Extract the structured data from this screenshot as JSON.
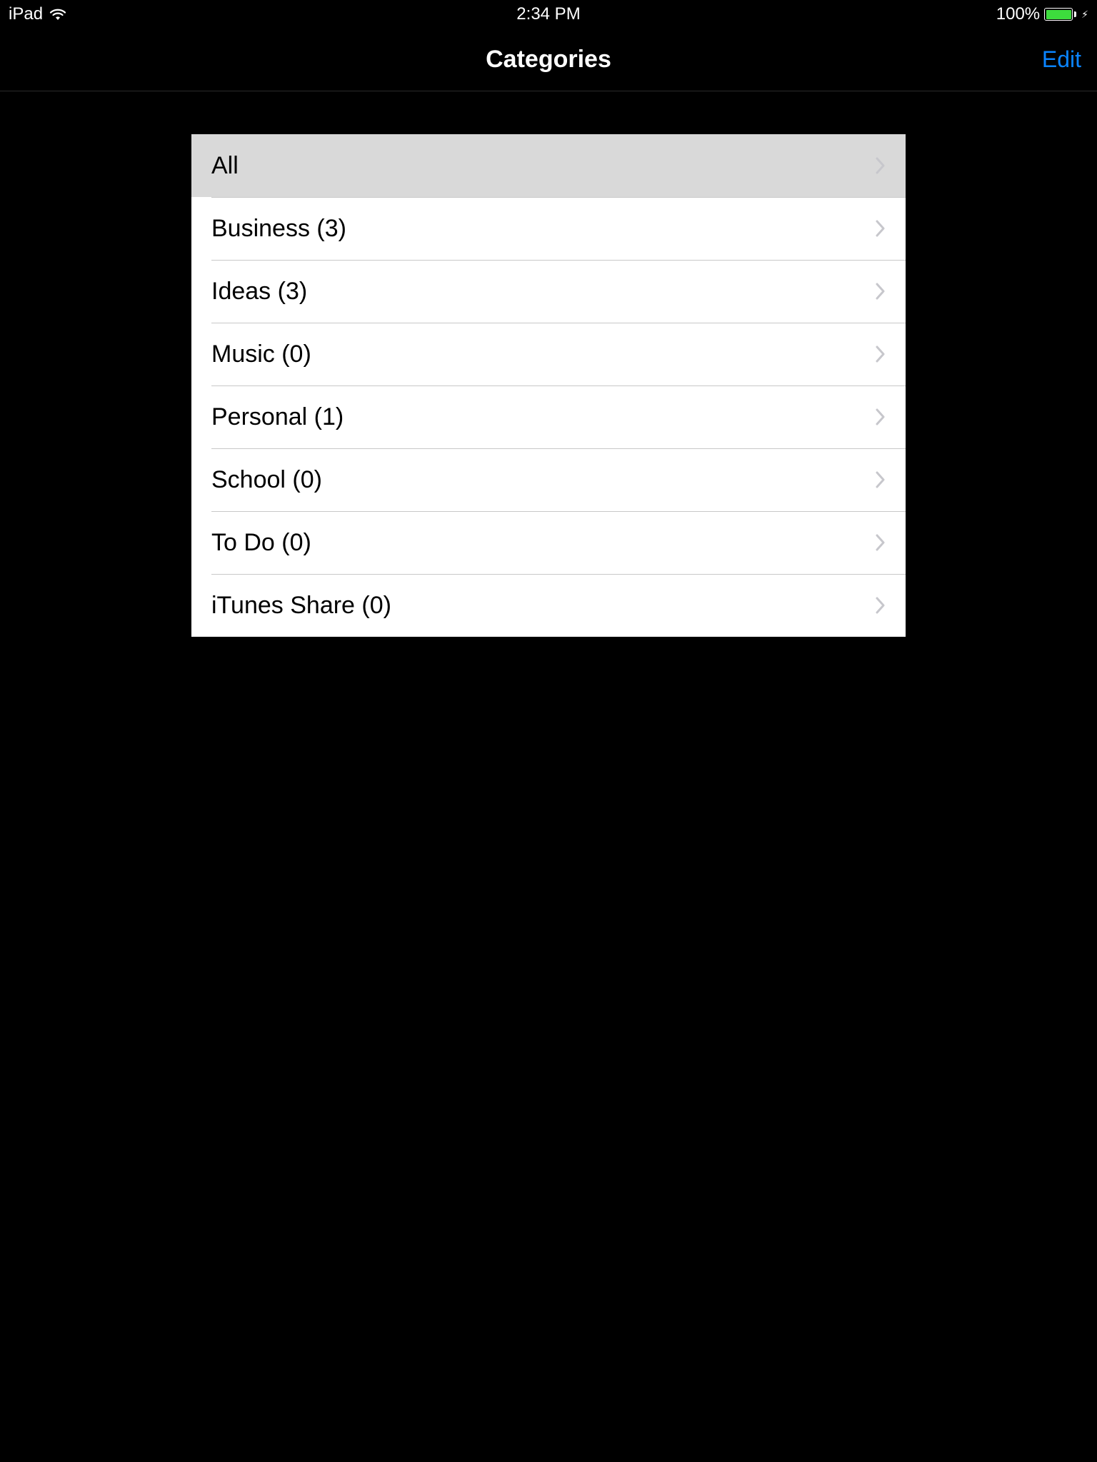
{
  "status": {
    "device": "iPad",
    "time": "2:34 PM",
    "battery_pct": "100%"
  },
  "nav": {
    "title": "Categories",
    "edit": "Edit"
  },
  "list": {
    "items": [
      {
        "label": "All",
        "selected": true
      },
      {
        "label": "Business (3)",
        "selected": false
      },
      {
        "label": "Ideas (3)",
        "selected": false
      },
      {
        "label": "Music (0)",
        "selected": false
      },
      {
        "label": "Personal (1)",
        "selected": false
      },
      {
        "label": "School (0)",
        "selected": false
      },
      {
        "label": "To Do (0)",
        "selected": false
      },
      {
        "label": "iTunes Share (0)",
        "selected": false
      }
    ]
  }
}
